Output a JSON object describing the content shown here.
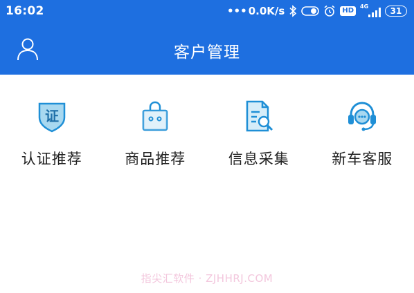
{
  "status_bar": {
    "time": "16:02",
    "dots": "•••",
    "network_speed": "0.0K/s",
    "hd_badge": "HD",
    "signal_type": "4G",
    "battery_level": "31",
    "icons": [
      "bluetooth-icon",
      "toggle-icon",
      "alarm-icon",
      "hd-icon",
      "signal-icon",
      "battery-icon"
    ]
  },
  "app_bar": {
    "title": "客户管理",
    "left_icon": "user-icon"
  },
  "grid": {
    "items": [
      {
        "label": "认证推荐",
        "icon": "shield-certify-icon",
        "icon_text": "证"
      },
      {
        "label": "商品推荐",
        "icon": "shopping-bag-icon"
      },
      {
        "label": "信息采集",
        "icon": "document-search-icon"
      },
      {
        "label": "新车客服",
        "icon": "headset-icon"
      }
    ]
  },
  "watermark": "指尖汇软件 · ZJHHRJ.COM",
  "colors": {
    "primary": "#1e6fe0",
    "icon_blue": "#1f8fd6",
    "text": "#222222",
    "background": "#ffffff",
    "watermark": "#f3c7dd"
  }
}
